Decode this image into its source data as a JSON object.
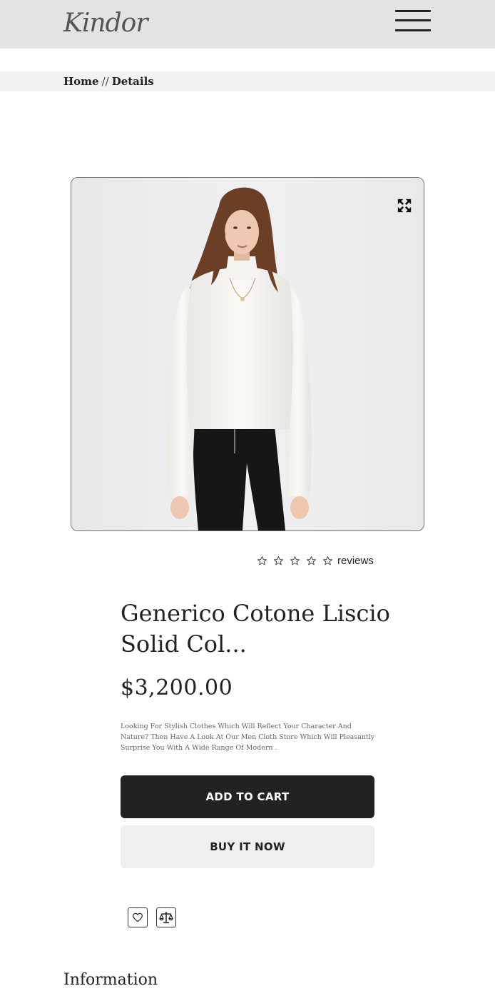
{
  "header": {
    "logo": "Kindor",
    "menu_icon": "hamburger-menu-icon"
  },
  "breadcrumb": {
    "home": "Home",
    "separator": "//",
    "current": "Details"
  },
  "product": {
    "image_alt": "Woman wearing white turtleneck sweater and black zip trousers",
    "expand_icon": "expand-arrows-icon",
    "rating_stars": 0,
    "rating_max": 5,
    "reviews_label": "reviews",
    "title": "Generico Cotone Liscio Solid Col...",
    "price": "$3,200.00",
    "description": "Looking For Stylish Clothes Which Will Reflect Your Character And Nature? Then Have A Look At Our Men Cloth Store Which Will Pleasantly Surprise You With A Wide Range Of Modern ."
  },
  "actions": {
    "add_to_cart": "ADD TO CART",
    "buy_now": "BUY IT NOW",
    "wishlist_icon": "heart-icon",
    "compare_icon": "scale-balance-icon"
  },
  "information": {
    "heading": "Information"
  },
  "colors": {
    "header_bg": "#e3e3e3",
    "breadcrumb_bg": "#f1f2f4",
    "primary_button": "#222222",
    "secondary_button": "#efefef"
  }
}
